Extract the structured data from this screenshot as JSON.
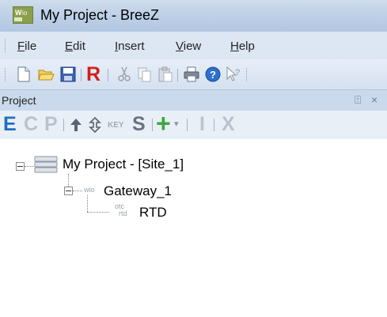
{
  "window": {
    "title": "My Project - BreeZ",
    "app_icon": "wio-app-icon"
  },
  "menu": {
    "items": [
      {
        "accel": "F",
        "rest": "ile"
      },
      {
        "accel": "E",
        "rest": "dit"
      },
      {
        "accel": "I",
        "rest": "nsert"
      },
      {
        "accel": "V",
        "rest": "iew"
      },
      {
        "accel": "H",
        "rest": "elp"
      }
    ]
  },
  "toolbar": {
    "buttons": [
      "new-icon",
      "open-icon",
      "save-icon",
      "r-icon",
      "cut-icon",
      "copy-icon",
      "paste-icon",
      "print-icon",
      "help-icon",
      "context-help-icon"
    ],
    "r_label": "R"
  },
  "panel": {
    "title": "Project",
    "pin_glyph": "⍐",
    "close_glyph": "×"
  },
  "tree_toolbar": {
    "e": "E",
    "c": "C",
    "p": "P",
    "key": "KEY",
    "s": "S",
    "add": "+",
    "dropdown": "▾",
    "i": "I",
    "x": "X",
    "colors": {
      "e": "#1f6fbf",
      "muted": "#b9c3cf",
      "s": "#6a7380",
      "add": "#3aa83a"
    }
  },
  "tree": {
    "root": {
      "label": "My Project - [Site_1]"
    },
    "gateway": {
      "tag": "wio",
      "label": "Gateway_1"
    },
    "rtd": {
      "tag_top": "otc",
      "tag_bottom": "rtd",
      "label": "RTD"
    }
  }
}
